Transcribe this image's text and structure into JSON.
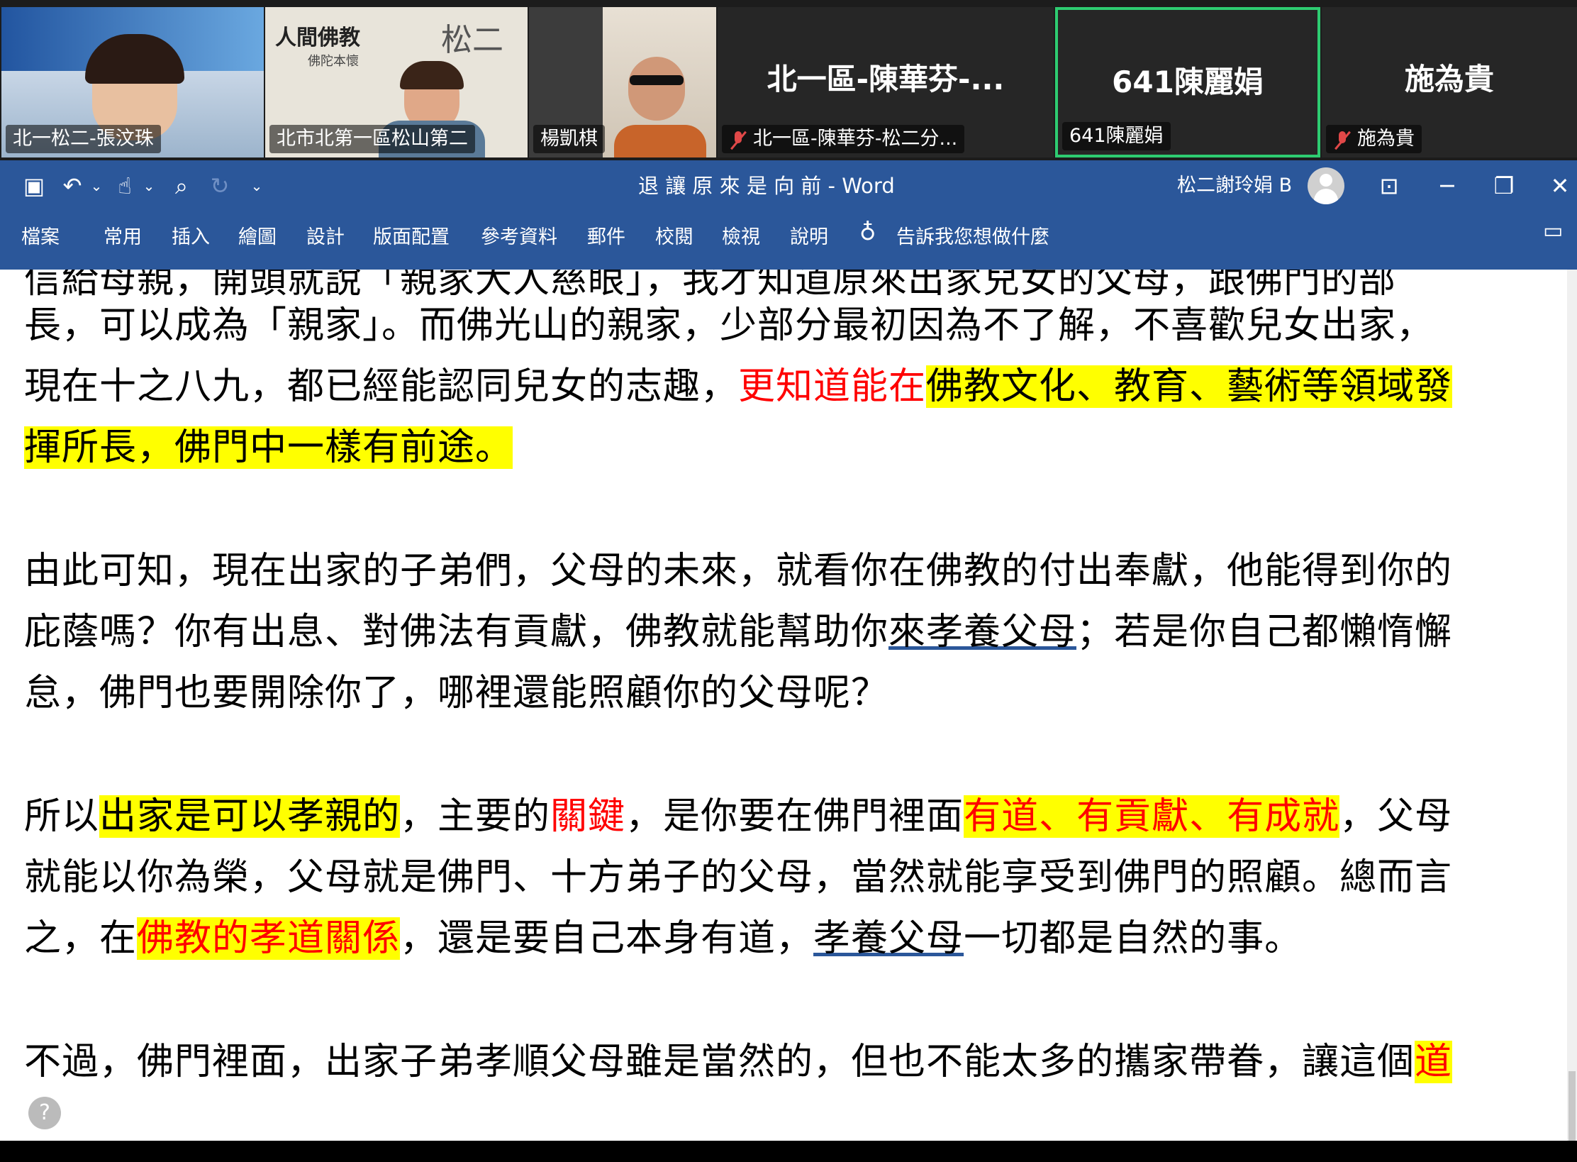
{
  "participants": [
    {
      "name": "北一松二-張汶珠",
      "type": "video"
    },
    {
      "name": "北市北第一區松山第二",
      "type": "video"
    },
    {
      "name": "楊凱棋",
      "type": "video"
    },
    {
      "display": "北一區-陳華芬-...",
      "name": "北一區-陳華芬-松二分...",
      "muted": true,
      "type": "avatar"
    },
    {
      "display": "641陳麗娟",
      "name": "641陳麗娟",
      "muted": false,
      "active": true,
      "type": "avatar"
    },
    {
      "display": "施為貴",
      "name": "施為貴",
      "muted": true,
      "type": "avatar"
    }
  ],
  "video_text": {
    "poster_top": "松二",
    "poster_book": "人間佛教",
    "poster_sub": "佛陀本懷"
  },
  "word": {
    "title": "退 讓 原 來 是 向 前  -  Word",
    "user": "松二謝玲娟 B",
    "tabs": [
      "檔案",
      "常用",
      "插入",
      "繪圖",
      "設計",
      "版面配置",
      "參考資料",
      "郵件",
      "校閱",
      "檢視",
      "說明"
    ],
    "tell_me": "告訴我您想做什麼"
  },
  "document": {
    "l0": "信給母親，開頭就說「親家大人慈眼」，我才知道原來出家兒女的父母，跟佛門的部",
    "l1": "長，可以成為「親家」。而佛光山的親家，少部分最初因為不了解，不喜歡兒女出家，",
    "l2a": "現在十之八九，都已經能認同兒女的志趣，",
    "l2b": "更知道能在",
    "l2c": "佛教文化、教育、藝術等領域發",
    "l3": "揮所長，佛門中一樣有前途。",
    "l4": "由此可知，現在出家的子弟們，父母的未來，就看你在佛教的付出奉獻，他能得到你的",
    "l5a": "庇蔭嗎？你有出息、對佛法有貢獻，佛教就能幫助你",
    "l5b": "來孝養父母",
    "l5c": "；若是你自己都懶惰懈",
    "l6": "怠，佛門也要開除你了，哪裡還能照顧你的父母呢？",
    "l7a": "所以",
    "l7b": "出家是可以孝親的",
    "l7c": "，主要的",
    "l7d": "關鍵",
    "l7e": "，是你要在佛門裡面",
    "l7f": "有道、有貢獻、有成就",
    "l7g": "，父母",
    "l8": "就能以你為榮，父母就是佛門、十方弟子的父母，當然就能享受到佛門的照顧。總而言",
    "l9a": "之，在",
    "l9b": "佛教的孝道關係",
    "l9c": "，還是要自己本身有道，",
    "l9d": "孝養父母",
    "l9e": "一切都是自然的事。",
    "l10a": "不過，佛門裡面，出家子弟孝順父母雖是當然的，但也不能太多的攜家帶眷，讓這個",
    "l10b": "道"
  },
  "colors": {
    "word_blue": "#2b579a",
    "highlight": "#ffff00",
    "red": "#ff0000",
    "active_border": "#2ecc71"
  }
}
